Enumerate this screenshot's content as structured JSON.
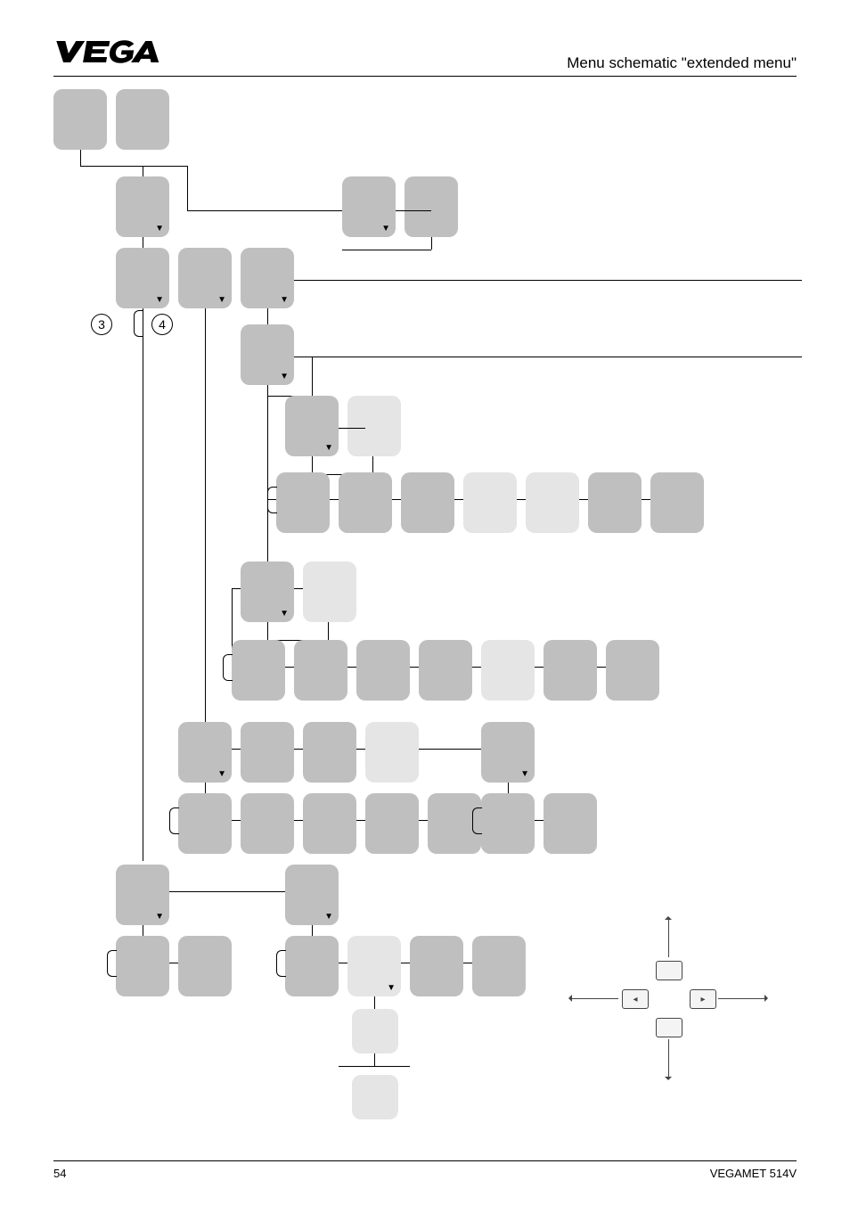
{
  "header": {
    "logo_text": "VEGA",
    "right_text": "Menu schematic \"extended menu\""
  },
  "labels": {
    "circled_3": "3",
    "circled_4": "4"
  },
  "footer": {
    "left": "54",
    "right": "VEGAMET 514V"
  },
  "diagram": {
    "description": "Menu schematic visualisation for extended menu",
    "rows": [
      [
        "node-gray",
        "node-gray"
      ],
      [
        "node-down",
        "spacer",
        "spacer",
        "node-down",
        "node"
      ],
      [
        "node-down",
        "node-down",
        "node-down"
      ],
      [
        "node-down",
        "spacer"
      ],
      [
        "node-down",
        "node"
      ],
      [
        "node",
        "node",
        "node",
        "node-light",
        "node-light",
        "node",
        "node"
      ],
      [
        "node-down",
        "node-light"
      ],
      [
        "node",
        "node",
        "node",
        "node",
        "node-light",
        "node",
        "node"
      ],
      [
        "node-down",
        "node",
        "node",
        "node-light",
        "node-down"
      ],
      [
        "node",
        "node",
        "node",
        "node",
        "node",
        "node",
        "node"
      ],
      [
        "node-down",
        "spacer",
        "node-down"
      ],
      [
        "node",
        "node",
        "spacer",
        "node",
        "node-light-down",
        "node",
        "node"
      ],
      [
        "spacer",
        "light"
      ],
      [
        "spacer",
        "light"
      ]
    ]
  }
}
